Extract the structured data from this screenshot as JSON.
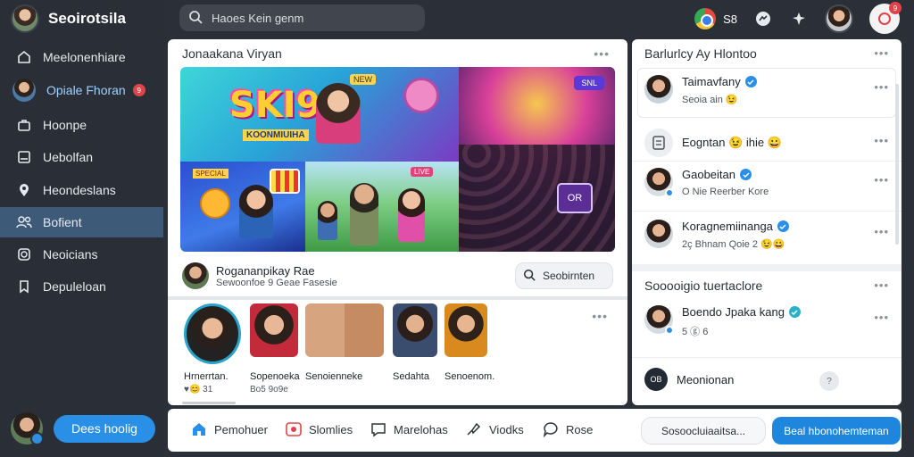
{
  "app": {
    "brand_name": "Seoirotsila"
  },
  "sidebar": {
    "items": [
      {
        "label": "Meelonenhiare",
        "icon": "home-icon"
      },
      {
        "label": "Opiale Fhoran",
        "icon": "avatar",
        "badge": "9"
      },
      {
        "label": "Hoonpe",
        "icon": "briefcase-icon"
      },
      {
        "label": "Uebolfan",
        "icon": "tv-icon"
      },
      {
        "label": "Heondeslans",
        "icon": "map-pin-icon"
      },
      {
        "label": "Bofient",
        "icon": "users-icon"
      },
      {
        "label": "Neoicians",
        "icon": "globe-icon"
      },
      {
        "label": "Depuleloan",
        "icon": "bookmark-icon"
      }
    ],
    "footer_button": "Dees hoolig"
  },
  "topbar": {
    "search_placeholder": "Haoes Kein genm",
    "notification_count": "S8",
    "top_badge": "9"
  },
  "post": {
    "header": "Jonaakana Viryan",
    "media_title": "SKI9",
    "media_subtitle": "KOONMIUIHA",
    "media_label_a": "NEW",
    "media_label_b": "SNL",
    "media_label_c": "SPECIAL",
    "media_label_d": "LIVE",
    "media_icon_text": "OR",
    "author_name": "Rogananpikay Rae",
    "author_meta": "Sewoonfoe 9 Geae Fasesie",
    "search_button": "Seobirnten"
  },
  "stories": [
    {
      "label": "Hrnerrtan.",
      "meta": "♥😊 31"
    },
    {
      "label": "Sopenoeka",
      "meta": "Bo5 9o9e"
    },
    {
      "label": "Senoienneke",
      "meta": ""
    },
    {
      "label": "Sedahta",
      "meta": ""
    },
    {
      "label": "Senoenom.",
      "meta": ""
    }
  ],
  "right_panel": {
    "title": "Barlurlcy Ay Hlontoo",
    "items": [
      {
        "name": "Taimavfany",
        "sub": "Seoia ain 😉",
        "verified": true
      },
      {
        "name": "Eogntan 😉 ihie 😀",
        "sub": "",
        "verified": false
      },
      {
        "name": "Gaobeitan",
        "sub": "O Nie Reerber Kore",
        "verified": true
      },
      {
        "name": "Koragnemiinanga",
        "sub": "2ç Bhnam Qoie 2 😉😀",
        "verified": true
      }
    ],
    "section_title": "Sooooigio tuertaclore",
    "section_items": [
      {
        "name": "Boendo Jpaka kang",
        "sub": "5 ⓖ 6",
        "verified": true
      },
      {
        "name": "Meonionan",
        "sub": "",
        "verified": false
      }
    ]
  },
  "bottombar": {
    "items": [
      {
        "label": "Pemohuer",
        "icon": "home-icon"
      },
      {
        "label": "Slomlies",
        "icon": "video-icon"
      },
      {
        "label": "Marelohas",
        "icon": "chat-icon"
      },
      {
        "label": "Viodks",
        "icon": "share-icon"
      },
      {
        "label": "Rose",
        "icon": "comment-icon"
      }
    ],
    "input_placeholder": "Sosoocluiaaitsa...",
    "action_button": "Beal hbonohemteman"
  },
  "colors": {
    "sidebar_bg": "#2a2f37",
    "active_item": "#3d5b78",
    "accent": "#2a8fe6",
    "badge_red": "#e2434b"
  }
}
